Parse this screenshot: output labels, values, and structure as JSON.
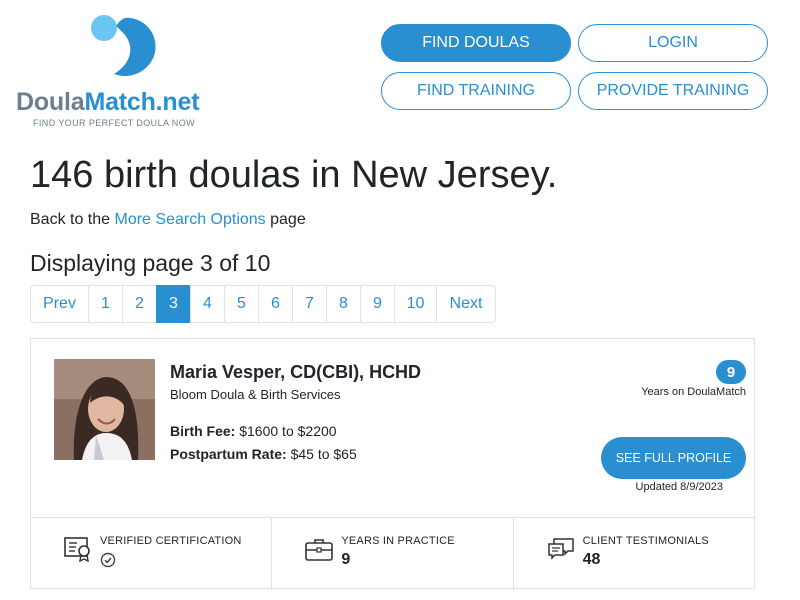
{
  "brand": {
    "name_part1": "Doula",
    "name_part2": "Match.net",
    "tagline": "FIND YOUR PERFECT DOULA NOW"
  },
  "nav": {
    "find_doulas": "FIND DOULAS",
    "login": "LOGIN",
    "find_training": "FIND TRAINING",
    "provide_training": "PROVIDE TRAINING"
  },
  "heading": {
    "title": "146 birth doulas in New Jersey.",
    "back_prefix": "Back to the ",
    "back_link": "More Search Options",
    "back_suffix": " page",
    "displaying": "Displaying page 3 of 10"
  },
  "pagination": {
    "prev": "Prev",
    "pages": [
      "1",
      "2",
      "3",
      "4",
      "5",
      "6",
      "7",
      "8",
      "9",
      "10"
    ],
    "current": "3",
    "next": "Next"
  },
  "profile": {
    "name": "Maria Vesper, CD(CBI), HCHD",
    "business": "Bloom Doula & Birth Services",
    "birth_fee_label": "Birth Fee:",
    "birth_fee_value": "$1600 to $2200",
    "postpartum_label": "Postpartum Rate:",
    "postpartum_value": "$45 to $65",
    "years_on_site": "9",
    "years_on_site_caption": "Years on DoulaMatch",
    "see_profile": "SEE FULL PROFILE",
    "updated": "Updated 8/9/2023"
  },
  "stats": {
    "verified_label": "VERIFIED CERTIFICATION",
    "years_label": "YEARS IN PRACTICE",
    "years_value": "9",
    "testimonials_label": "CLIENT TESTIMONIALS",
    "testimonials_value": "48"
  },
  "colors": {
    "accent": "#2a8fd1",
    "logo_grey": "#6b7f8c",
    "border": "#dee2e6"
  }
}
